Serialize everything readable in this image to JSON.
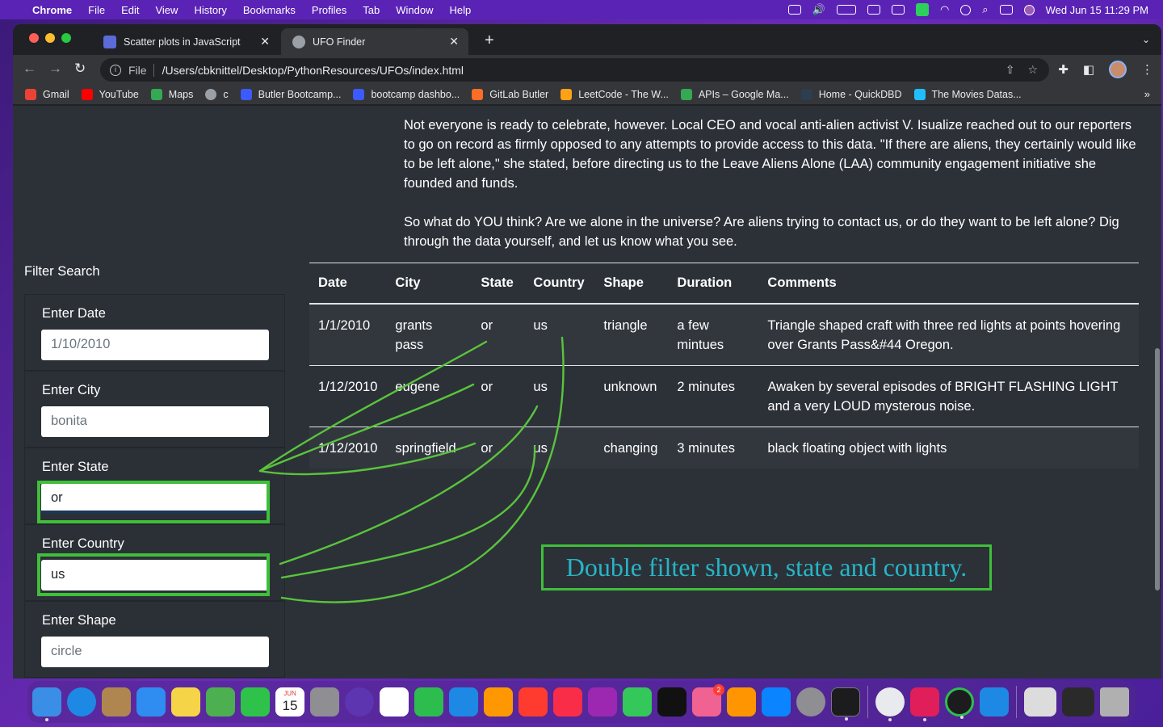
{
  "menubar": {
    "apple_icon": "",
    "app_name": "Chrome",
    "items": [
      "File",
      "Edit",
      "View",
      "History",
      "Bookmarks",
      "Profiles",
      "Tab",
      "Window",
      "Help"
    ],
    "clock": "Wed Jun 15  11:29 PM"
  },
  "tabs": [
    {
      "title": "Scatter plots in JavaScript",
      "icon": "chart-favicon-icon",
      "close": "✕"
    },
    {
      "title": "UFO Finder",
      "icon": "globe-favicon-icon",
      "close": "✕"
    }
  ],
  "new_tab": "+",
  "tab_menu": "⌄",
  "omnibox": {
    "scheme": "File",
    "url": "/Users/cbknittel/Desktop/PythonResources/UFOs/index.html"
  },
  "bookmarks": [
    {
      "label": "Gmail",
      "color": "#ea4335"
    },
    {
      "label": "YouTube",
      "color": "#ff0000"
    },
    {
      "label": "Maps",
      "color": "#34a853"
    },
    {
      "label": "c",
      "color": "#9aa0a6"
    },
    {
      "label": "Butler Bootcamp...",
      "color": "#3d5afe"
    },
    {
      "label": "bootcamp dashbo...",
      "color": "#3d5afe"
    },
    {
      "label": "GitLab Butler",
      "color": "#fc6d26"
    },
    {
      "label": "LeetCode - The W...",
      "color": "#ffa116"
    },
    {
      "label": "APIs – Google Ma...",
      "color": "#34a853"
    },
    {
      "label": "Home - QuickDBD",
      "color": "#2c3e50"
    },
    {
      "label": "The Movies Datas...",
      "color": "#20beff"
    }
  ],
  "bookmarks_more": "»",
  "article": {
    "para1": "Not everyone is ready to celebrate, however. Local CEO and vocal anti-alien activist V. Isualize reached out to our reporters to go on record as firmly opposed to any attempts to provide access to this data. \"If there are aliens, they certainly would like to be left alone,\" she stated, before directing us to the Leave Aliens Alone (LAA) community engagement initiative she founded and funds.",
    "para2": "So what do YOU think? Are we alone in the universe? Are aliens trying to contact us, or do they want to be left alone? Dig through the data yourself, and let us know what you see."
  },
  "filter": {
    "title": "Filter Search",
    "fields": [
      {
        "label": "Enter Date",
        "value": "1/10/2010"
      },
      {
        "label": "Enter City",
        "value": "bonita"
      },
      {
        "label": "Enter State",
        "value": "or"
      },
      {
        "label": "Enter Country",
        "value": "us"
      },
      {
        "label": "Enter Shape",
        "value": "circle"
      }
    ]
  },
  "table": {
    "headers": [
      "Date",
      "City",
      "State",
      "Country",
      "Shape",
      "Duration",
      "Comments"
    ],
    "rows": [
      [
        "1/1/2010",
        "grants pass",
        "or",
        "us",
        "triangle",
        "a few mintues",
        "Triangle shaped craft with three red lights at points hovering over Grants Pass&#44 Oregon."
      ],
      [
        "1/12/2010",
        "eugene",
        "or",
        "us",
        "unknown",
        "2 minutes",
        "Awaken by several episodes of BRIGHT FLASHING LIGHT and a very LOUD mysterous noise."
      ],
      [
        "1/12/2010",
        "springfield",
        "or",
        "us",
        "changing",
        "3 minutes",
        "black floating object with lights"
      ]
    ]
  },
  "annotation": "Double filter shown, state and country.",
  "colors": {
    "highlight": "#3fbf3a",
    "annotation_text": "#27b5c6",
    "page_bg": "#2c3138"
  },
  "dock": {
    "apps": [
      {
        "name": "finder-app-icon",
        "color": "#3a8ee6"
      },
      {
        "name": "safari-app-icon",
        "color": "#1e88e5"
      },
      {
        "name": "contacts-app-icon",
        "color": "#b08650"
      },
      {
        "name": "mail-app-icon",
        "color": "#2f8cf0"
      },
      {
        "name": "notes-app-icon",
        "color": "#f5d547"
      },
      {
        "name": "maps-app-icon",
        "color": "#4caf50"
      },
      {
        "name": "facetime-app-icon",
        "color": "#2fc24a"
      },
      {
        "name": "calendar-app-icon",
        "color": "#ffffff"
      },
      {
        "name": "launchpad-app-icon",
        "color": "#8e8e93"
      },
      {
        "name": "siri-app-icon",
        "color": "#5e35b1"
      },
      {
        "name": "reminders-app-icon",
        "color": "#ffffff"
      },
      {
        "name": "numbers-app-icon",
        "color": "#2dbd4e"
      },
      {
        "name": "keynote-app-icon",
        "color": "#1e88e5"
      },
      {
        "name": "pages-app-icon",
        "color": "#ff9800"
      },
      {
        "name": "news-app-icon",
        "color": "#ff3b30"
      },
      {
        "name": "music-app-icon",
        "color": "#fa2d48"
      },
      {
        "name": "podcasts-app-icon",
        "color": "#9c27b0"
      },
      {
        "name": "messages-app-icon",
        "color": "#34c759"
      },
      {
        "name": "tv-app-icon",
        "color": "#111111"
      },
      {
        "name": "photos-app-icon",
        "color": "#f06292"
      },
      {
        "name": "books-app-icon",
        "color": "#ff9500"
      },
      {
        "name": "appstore-app-icon",
        "color": "#0a84ff"
      },
      {
        "name": "settings-app-icon",
        "color": "#8e8e93"
      },
      {
        "name": "terminal-app-icon",
        "color": "#1c1c1e"
      }
    ],
    "apps_right": [
      {
        "name": "chrome-app-icon",
        "color": "#e8eaed"
      },
      {
        "name": "slack-app-icon",
        "color": "#e01e5a"
      },
      {
        "name": "activity-app-icon",
        "color": "#1c1c1e"
      },
      {
        "name": "vscode-app-icon",
        "color": "#1e88e5"
      }
    ],
    "calendar_day": "15",
    "calendar_month": "JUN",
    "photos_badge": "2",
    "trash": "trash-app-icon"
  }
}
